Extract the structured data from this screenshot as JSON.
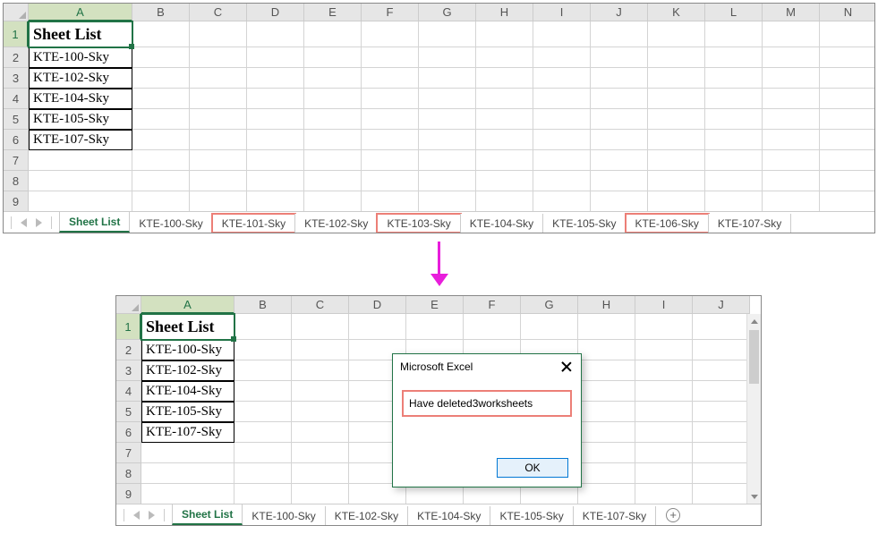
{
  "pane1": {
    "cols": [
      "A",
      "B",
      "C",
      "D",
      "E",
      "F",
      "G",
      "H",
      "I",
      "J",
      "K",
      "L",
      "M",
      "N"
    ],
    "rows": [
      "1",
      "2",
      "3",
      "4",
      "5",
      "6",
      "7",
      "8",
      "9"
    ],
    "a1": "Sheet List",
    "data": [
      "KTE-100-Sky",
      "KTE-102-Sky",
      "KTE-104-Sky",
      "KTE-105-Sky",
      "KTE-107-Sky"
    ],
    "tabs": [
      "Sheet List",
      "KTE-100-Sky",
      "KTE-101-Sky",
      "KTE-102-Sky",
      "KTE-103-Sky",
      "KTE-104-Sky",
      "KTE-105-Sky",
      "KTE-106-Sky",
      "KTE-107-Sky"
    ],
    "active_tab": "Sheet List",
    "highlighted_tabs": [
      "KTE-101-Sky",
      "KTE-103-Sky",
      "KTE-106-Sky"
    ]
  },
  "pane2": {
    "cols": [
      "A",
      "B",
      "C",
      "D",
      "E",
      "F",
      "G",
      "H",
      "I",
      "J"
    ],
    "rows": [
      "1",
      "2",
      "3",
      "4",
      "5",
      "6",
      "7",
      "8",
      "9"
    ],
    "a1": "Sheet List",
    "data": [
      "KTE-100-Sky",
      "KTE-102-Sky",
      "KTE-104-Sky",
      "KTE-105-Sky",
      "KTE-107-Sky"
    ],
    "tabs": [
      "Sheet List",
      "KTE-100-Sky",
      "KTE-102-Sky",
      "KTE-104-Sky",
      "KTE-105-Sky",
      "KTE-107-Sky"
    ],
    "active_tab": "Sheet List"
  },
  "dialog": {
    "title": "Microsoft Excel",
    "message": "Have deleted3worksheets",
    "ok": "OK"
  }
}
